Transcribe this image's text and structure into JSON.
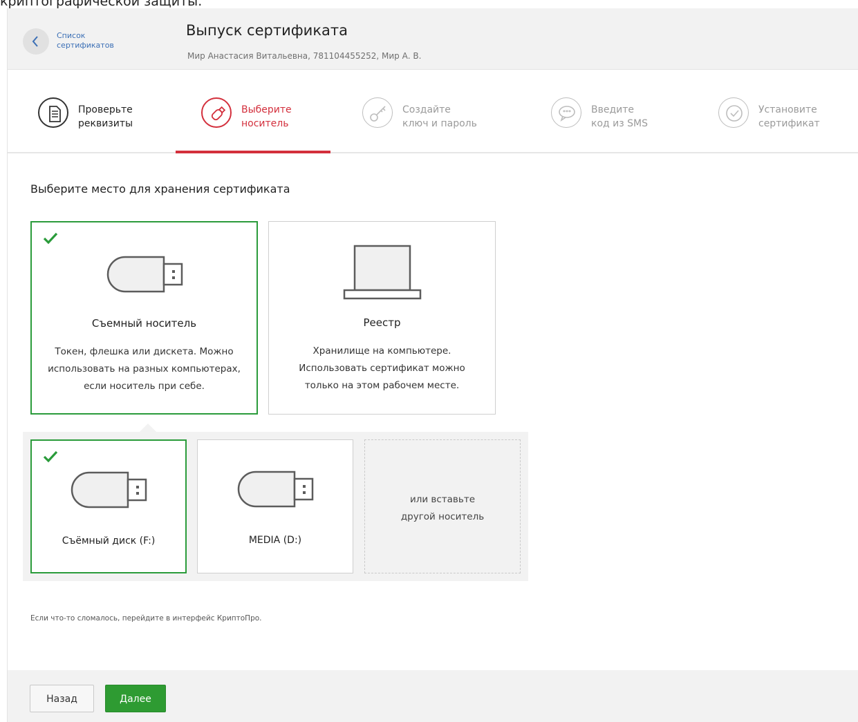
{
  "top_fragment": "криптографической защиты.",
  "header": {
    "back_link": "Список сертификатов",
    "title": "Выпуск сертификата",
    "subtitle": "Мир Анастасия Витальевна, 781104455252, Мир А. В."
  },
  "steps": [
    {
      "line1": "Проверьте",
      "line2": "реквизиты",
      "state": "done",
      "icon": "document-icon"
    },
    {
      "line1": "Выберите",
      "line2": "носитель",
      "state": "active",
      "icon": "usb-pen-icon"
    },
    {
      "line1": "Создайте",
      "line2": "ключ и пароль",
      "state": "pending",
      "icon": "key-icon"
    },
    {
      "line1": "Введите",
      "line2": "код из SMS",
      "state": "pending",
      "icon": "sms-icon"
    },
    {
      "line1": "Установите",
      "line2": "сертификат",
      "state": "pending",
      "icon": "checkmark-icon"
    }
  ],
  "main": {
    "section_title": "Выберите место для хранения сертификата",
    "storage_options": [
      {
        "title": "Съемный носитель",
        "desc": [
          "Токен, флешка или дискета. Можно",
          "использовать на разных компьютерах,",
          "если носитель при себе."
        ],
        "selected": true,
        "icon": "usb-drive-icon"
      },
      {
        "title": "Реестр",
        "desc": [
          "Хранилище на компьютере.",
          "Использовать сертификат можно",
          "только на этом рабочем месте."
        ],
        "selected": false,
        "icon": "laptop-icon"
      }
    ],
    "devices": [
      {
        "name": "Съёмный диск (F:)",
        "selected": true,
        "icon": "usb-drive-icon"
      },
      {
        "name": "MEDIA (D:)",
        "selected": false,
        "icon": "usb-drive-icon"
      }
    ],
    "insert_other": [
      "или вставьте",
      "другой носитель"
    ],
    "hint": "Если что-то сломалось, перейдите в интерфейс КриптоПро."
  },
  "footer": {
    "back_label": "Назад",
    "next_label": "Далее"
  },
  "colors": {
    "accent_red": "#d32f3c",
    "selected_green": "#2a9b3a",
    "button_green": "#2e9b32",
    "link_blue": "#3b6fb5"
  }
}
